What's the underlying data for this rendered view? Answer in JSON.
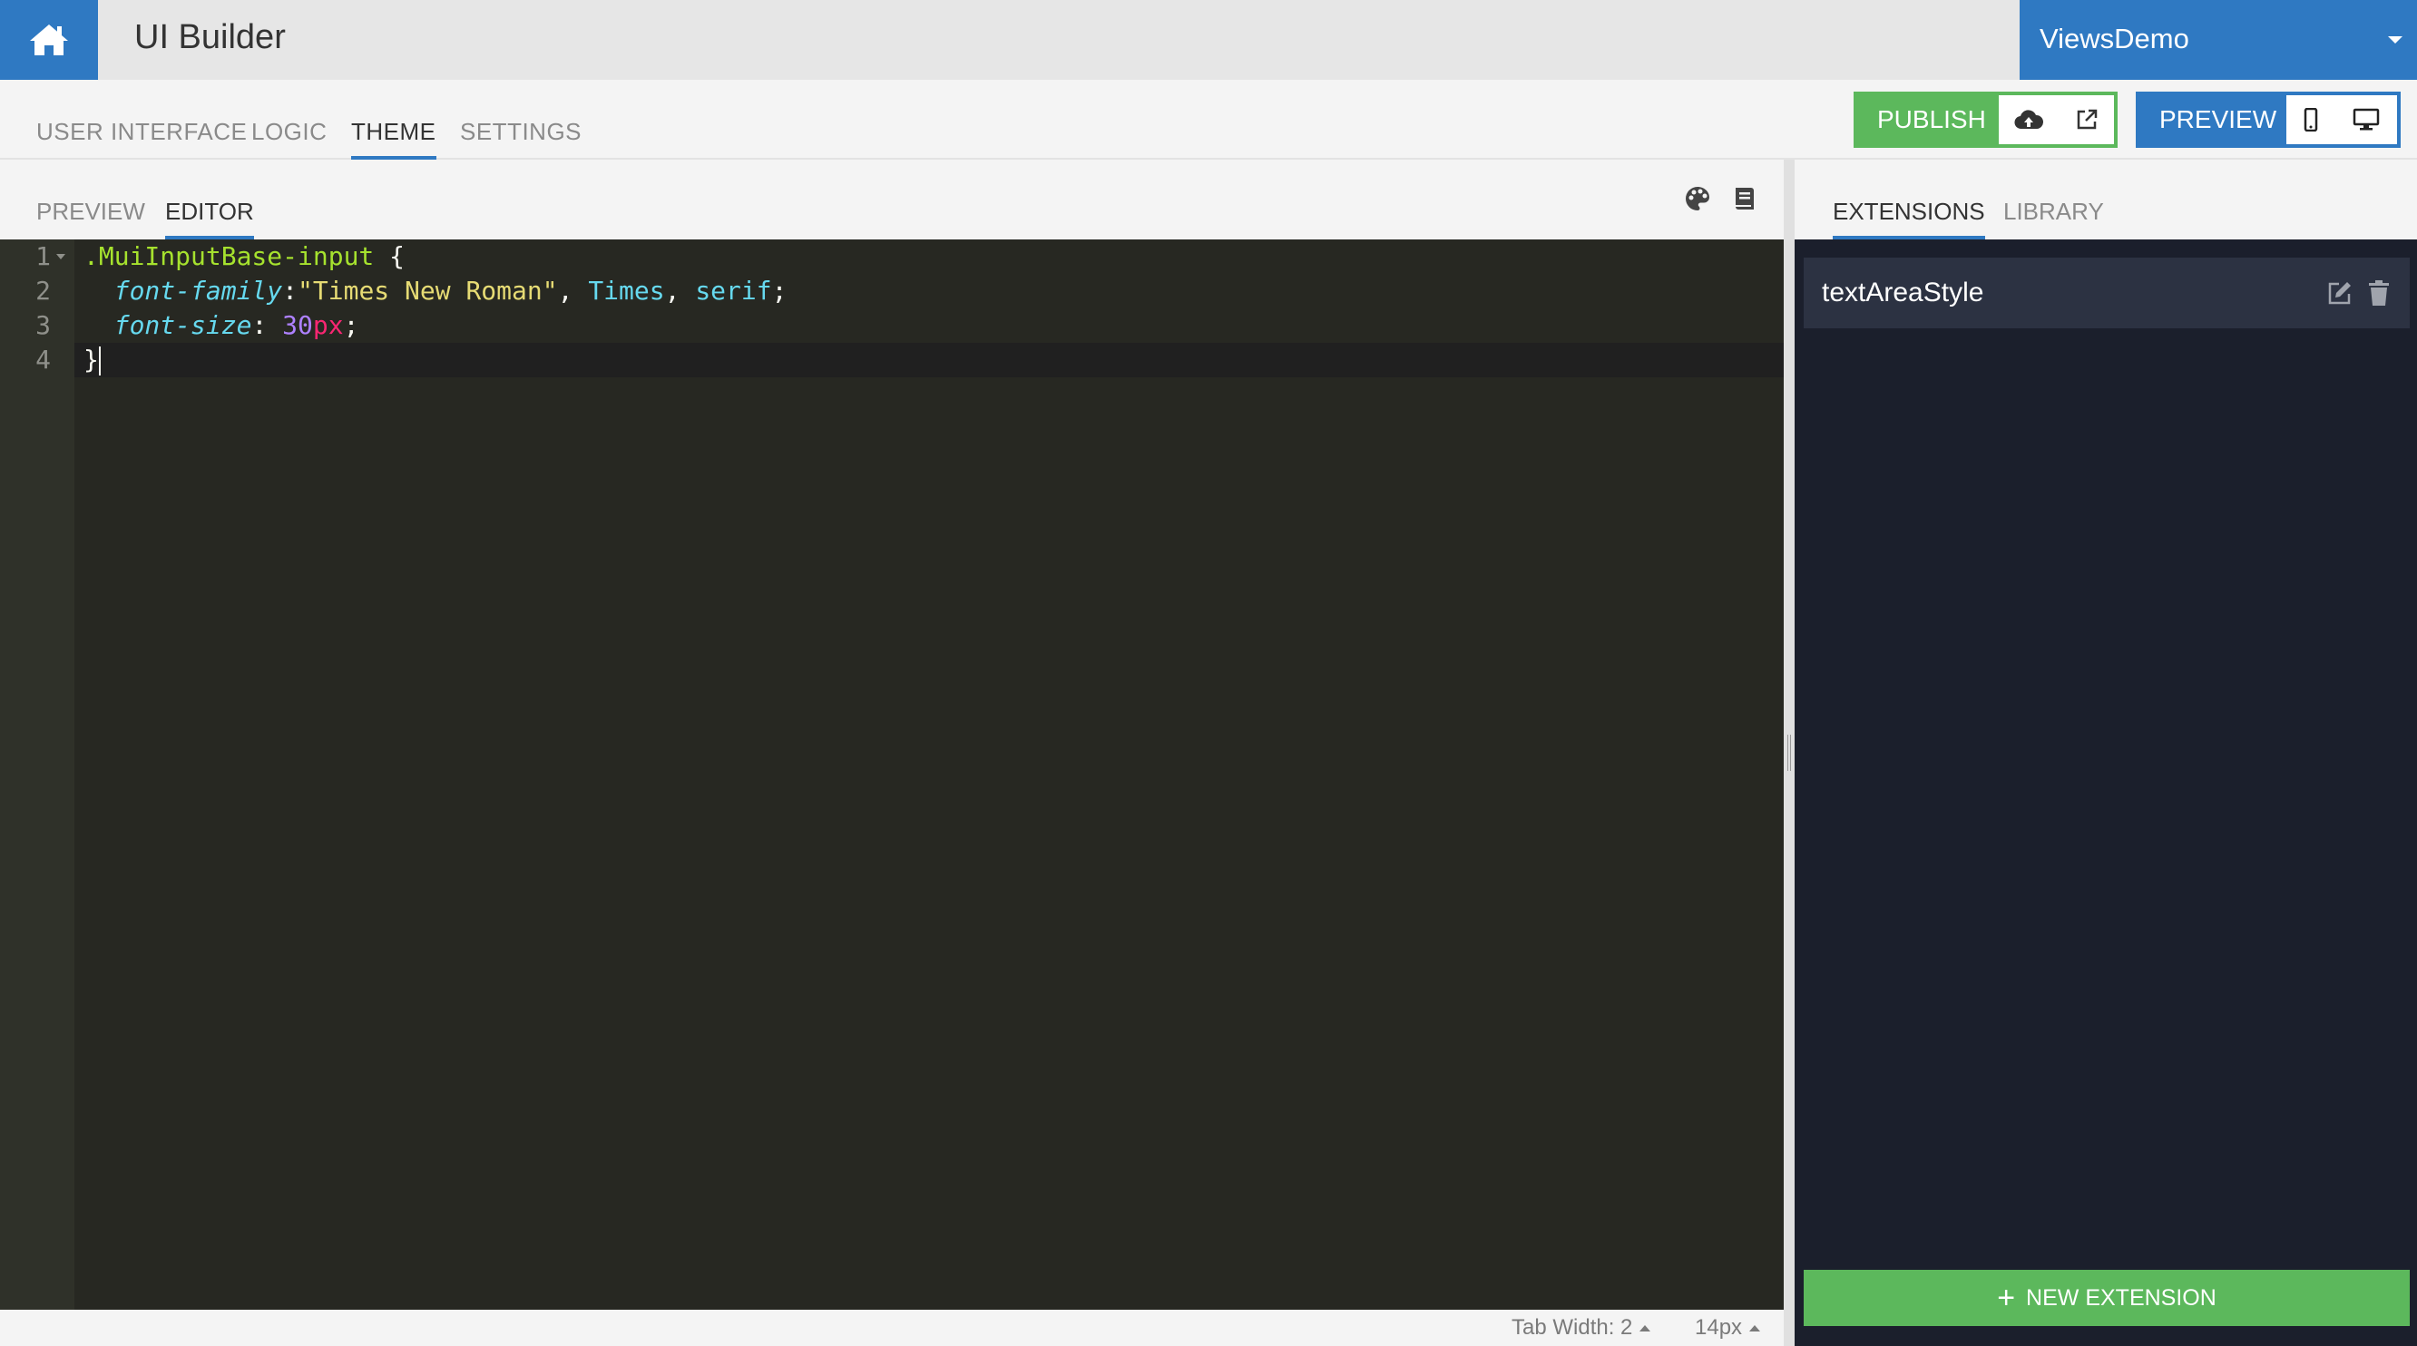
{
  "app": {
    "title": "UI Builder"
  },
  "project": {
    "name": "ViewsDemo"
  },
  "main_tabs": [
    {
      "label": "USER INTERFACE",
      "active": false
    },
    {
      "label": "LOGIC",
      "active": false
    },
    {
      "label": "THEME",
      "active": true
    },
    {
      "label": "SETTINGS",
      "active": false
    }
  ],
  "publish": {
    "label": "PUBLISH",
    "icons": [
      "cloud-upload-icon",
      "external-link-icon"
    ]
  },
  "preview": {
    "label": "PREVIEW",
    "icons": [
      "mobile-icon",
      "desktop-icon"
    ]
  },
  "editor_tabs": [
    {
      "label": "PREVIEW",
      "active": false
    },
    {
      "label": "EDITOR",
      "active": true
    }
  ],
  "editor": {
    "line_numbers": [
      "1",
      "2",
      "3",
      "4"
    ],
    "code": {
      "selector": ".MuiInputBase-input",
      "open_brace": "{",
      "prop1": "font-family",
      "colon": ":",
      "value1_string": "\"Times New Roman\"",
      "comma": ",",
      "value1_times": "Times",
      "value1_serif": "serif",
      "semicolon": ";",
      "prop2": "font-size",
      "value2_number": "30",
      "value2_unit": "px",
      "close_brace": "}"
    },
    "status": {
      "tab_width": "Tab Width: 2",
      "font_size": "14px"
    }
  },
  "right_tabs": [
    {
      "label": "EXTENSIONS",
      "active": true
    },
    {
      "label": "LIBRARY",
      "active": false
    }
  ],
  "extensions": [
    {
      "name": "textAreaStyle"
    }
  ],
  "new_extension_label": "NEW EXTENSION",
  "colors": {
    "primary": "#2f79c2",
    "success": "#5cb85c",
    "editor_bg": "#272822",
    "panel_bg": "#1b1f2c"
  }
}
